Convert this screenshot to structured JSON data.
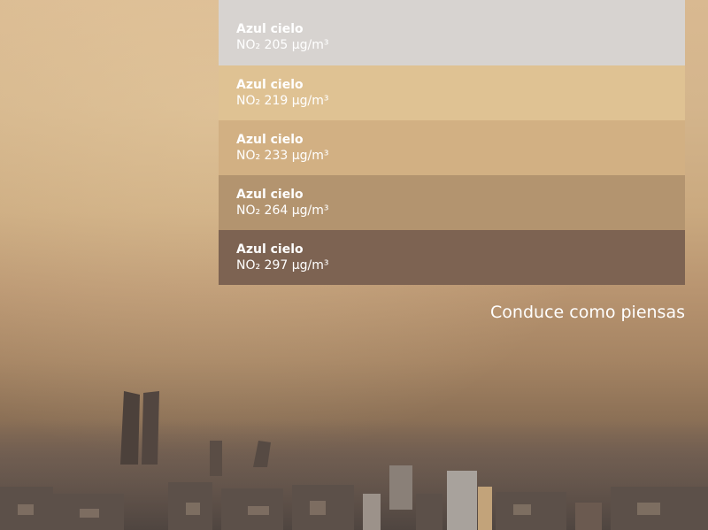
{
  "swatches": [
    {
      "name": "Azul cielo",
      "reading": "NO₂ 205 μg/m³",
      "color": "#d7d3d0"
    },
    {
      "name": "Azul cielo",
      "reading": "NO₂ 219 μg/m³",
      "color": "#dfc293"
    },
    {
      "name": "Azul cielo",
      "reading": "NO₂ 233 μg/m³",
      "color": "#d2b083"
    },
    {
      "name": "Azul cielo",
      "reading": "NO₂ 264 μg/m³",
      "color": "#b3946f"
    },
    {
      "name": "Azul cielo",
      "reading": "NO₂ 297 μg/m³",
      "color": "#7d6352"
    }
  ],
  "tagline": "Conduce como piensas"
}
